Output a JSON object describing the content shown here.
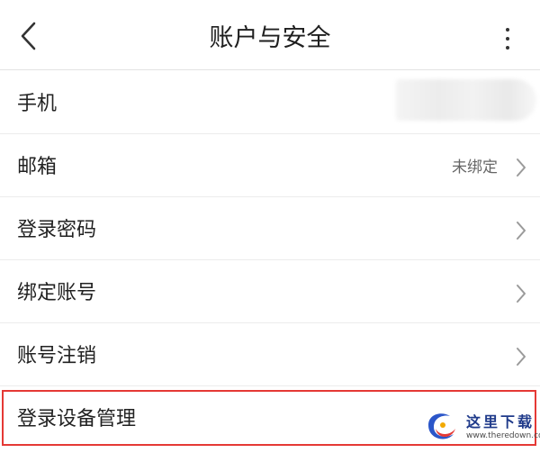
{
  "header": {
    "title": "账户与安全",
    "back_icon": "chevron-left-icon",
    "more_icon": "more-vertical-icon"
  },
  "rows": [
    {
      "label": "手机",
      "value": "",
      "chevron": false
    },
    {
      "label": "邮箱",
      "value": "未绑定",
      "chevron": true
    },
    {
      "label": "登录密码",
      "value": "",
      "chevron": true
    },
    {
      "label": "绑定账号",
      "value": "",
      "chevron": true
    },
    {
      "label": "账号注销",
      "value": "",
      "chevron": true
    },
    {
      "label": "登录设备管理",
      "value": "",
      "chevron": false
    }
  ],
  "watermark": {
    "text": "这里下载",
    "url": "www.theredown.com"
  },
  "colors": {
    "highlight": "#e53935",
    "divider": "#ececec",
    "watermark": "#1f3a8a"
  }
}
